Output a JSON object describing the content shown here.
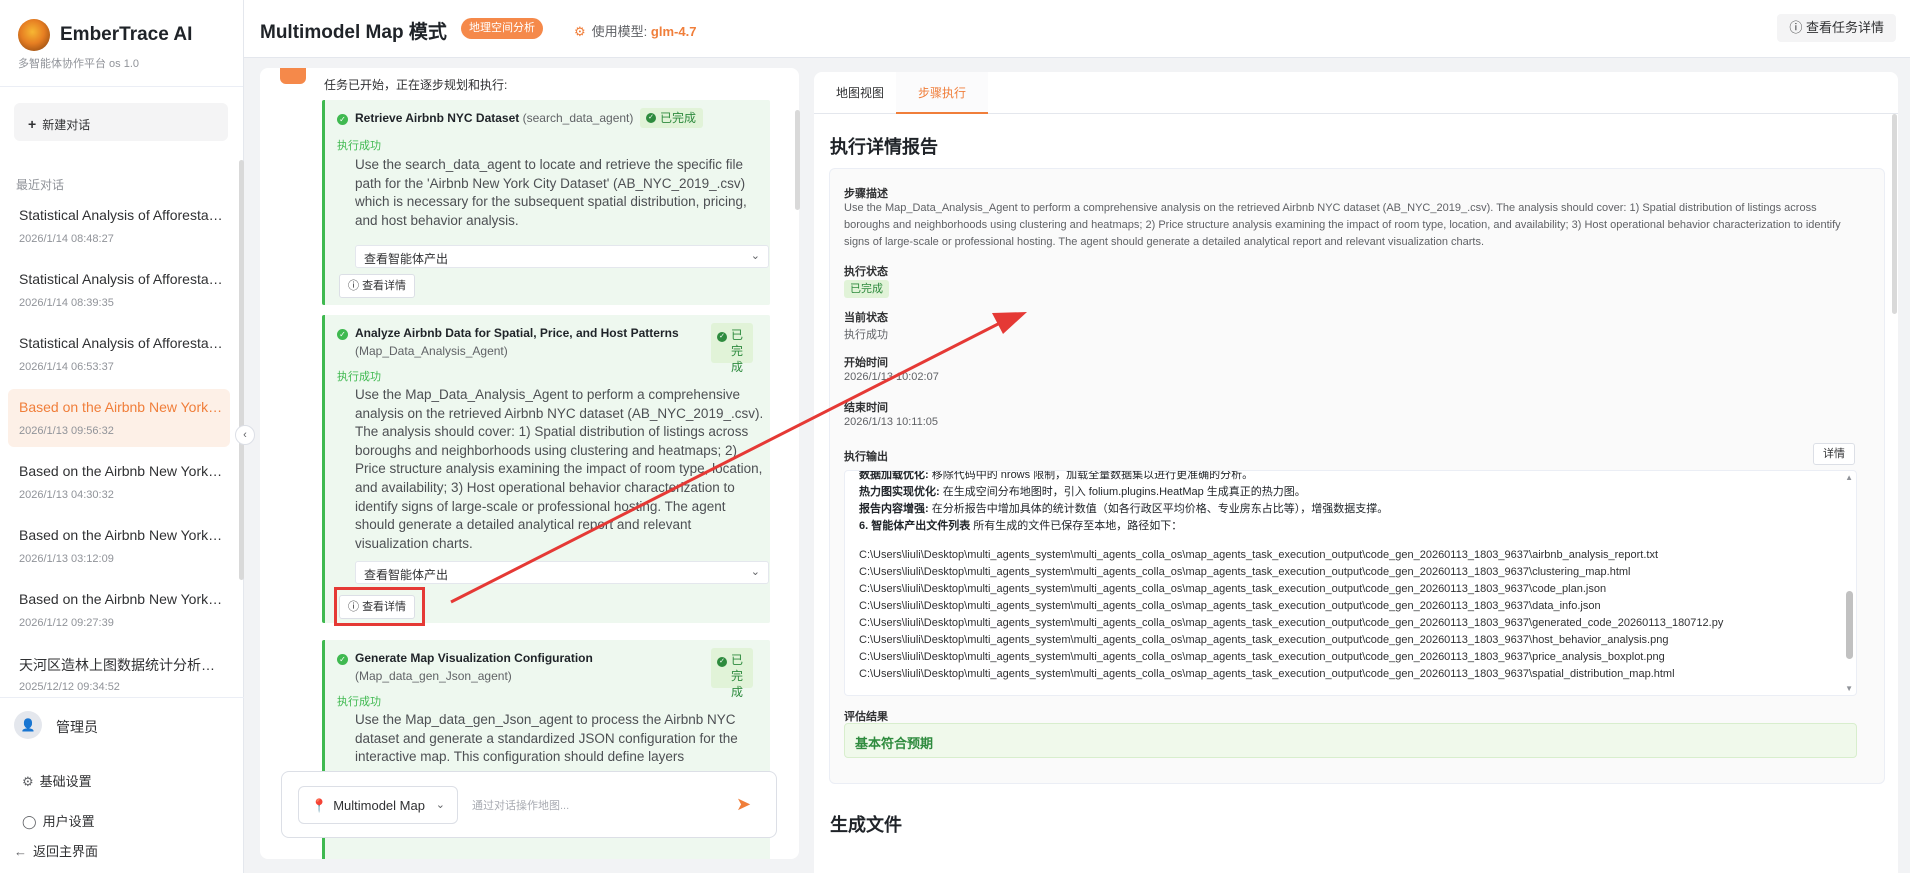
{
  "app": {
    "name": "EmberTrace AI",
    "subtitle": "多智能体协作平台 os 1.0"
  },
  "sidebar": {
    "new_chat": "新建对话",
    "recent_label": "最近对话",
    "history": [
      {
        "title": "Statistical Analysis of Afforestation...",
        "date": "2026/1/14 08:48:27",
        "active": false
      },
      {
        "title": "Statistical Analysis of Afforestation...",
        "date": "2026/1/14 08:39:35",
        "active": false
      },
      {
        "title": "Statistical Analysis of Afforestation...",
        "date": "2026/1/14 06:53:37",
        "active": false
      },
      {
        "title": "Based on the Airbnb New York City...",
        "date": "2026/1/13 09:56:32",
        "active": true
      },
      {
        "title": "Based on the Airbnb New York City...",
        "date": "2026/1/13 04:30:32",
        "active": false
      },
      {
        "title": "Based on the Airbnb New York City...",
        "date": "2026/1/13 03:12:09",
        "active": false
      },
      {
        "title": "Based on the Airbnb New York City...",
        "date": "2026/1/12 09:27:39",
        "active": false
      },
      {
        "title": "天河区造林上图数据统计分析及可视化",
        "date": "2025/12/12 09:34:52",
        "active": false
      }
    ],
    "user": "管理员",
    "settings": "基础设置",
    "user_settings": "用户设置",
    "back": "返回主界面"
  },
  "header": {
    "title": "Multimodel Map 模式",
    "badge": "地理空间分析",
    "model_label": "使用模型:",
    "model_value": "glm-4.7",
    "task_detail": "查看任务详情"
  },
  "chat": {
    "intro": "任务已开始，正在逐步规划和执行:",
    "tasks": [
      {
        "title": "Retrieve Airbnb NYC Dataset",
        "agent": "(search_data_agent)",
        "status": "已完成",
        "result": "执行成功",
        "desc": "Use the search_data_agent to locate and retrieve the specific file path for the 'Airbnb New York City Dataset' (AB_NYC_2019_.csv) which is necessary for the subsequent spatial distribution, pricing, and host behavior analysis.",
        "select": "查看智能体产出",
        "detail": "查看详情"
      },
      {
        "title": "Analyze Airbnb Data for Spatial, Price, and Host Patterns",
        "agent": "(Map_Data_Analysis_Agent)",
        "status_line1": "已完",
        "status_line2": "成",
        "result": "执行成功",
        "desc": "Use the Map_Data_Analysis_Agent to perform a comprehensive analysis on the retrieved Airbnb NYC dataset (AB_NYC_2019_.csv). The analysis should cover: 1) Spatial distribution of listings across boroughs and neighborhoods using clustering and heatmaps; 2) Price structure analysis examining the impact of room type, location, and availability; 3) Host operational behavior characterization to identify signs of large-scale or professional hosting. The agent should generate a detailed analytical report and relevant visualization charts.",
        "select": "查看智能体产出",
        "detail": "查看详情"
      },
      {
        "title": "Generate Map Visualization Configuration",
        "agent": "(Map_data_gen_Json_agent)",
        "status_line1": "已完",
        "status_line2": "成",
        "result": "执行成功",
        "desc": "Use the Map_data_gen_Json_agent to process the Airbnb NYC dataset and generate a standardized JSON configuration for the interactive map. This configuration should define layers"
      }
    ],
    "mode": "Multimodel Map",
    "placeholder": "通过对话操作地图..."
  },
  "right": {
    "tabs": [
      "地图视图",
      "步骤执行"
    ],
    "active_tab": 1,
    "report_title": "执行详情报告",
    "step_desc_label": "步骤描述",
    "step_desc": "Use the Map_Data_Analysis_Agent to perform a comprehensive analysis on the retrieved Airbnb NYC dataset (AB_NYC_2019_.csv). The analysis should cover: 1) Spatial distribution of listings across boroughs and neighborhoods using clustering and heatmaps; 2) Price structure analysis examining the impact of room type, location, and availability; 3) Host operational behavior characterization to identify signs of large-scale or professional hosting. The agent should generate a detailed analytical report and relevant visualization charts.",
    "exec_status_label": "执行状态",
    "exec_status": "已完成",
    "current_status_label": "当前状态",
    "current_status": "执行成功",
    "start_label": "开始时间",
    "start_time": "2026/1/13 10:02:07",
    "end_label": "结束时间",
    "end_time": "2026/1/13 10:11:05",
    "output_label": "执行输出",
    "output_detail": "详情",
    "output_lines": [
      {
        "bold": "数据加载优化:",
        "text": " 移除代码中的 nrows 限制，加载全量数据集以进行更准确的分析。"
      },
      {
        "bold": "热力图实现优化:",
        "text": " 在生成空间分布地图时，引入 folium.plugins.HeatMap 生成真正的热力图。"
      },
      {
        "bold": "报告内容增强:",
        "text": " 在分析报告中增加具体的统计数值（如各行政区平均价格、专业房东占比等），增强数据支撑。"
      },
      {
        "bold": "6. 智能体产出文件列表",
        "text": " 所有生成的文件已保存至本地，路径如下："
      }
    ],
    "output_paths": [
      "C:\\Users\\liuli\\Desktop\\multi_agents_system\\multi_agents_colla_os\\map_agents_task_execution_output\\code_gen_20260113_1803_9637\\airbnb_analysis_report.txt",
      "C:\\Users\\liuli\\Desktop\\multi_agents_system\\multi_agents_colla_os\\map_agents_task_execution_output\\code_gen_20260113_1803_9637\\clustering_map.html",
      "C:\\Users\\liuli\\Desktop\\multi_agents_system\\multi_agents_colla_os\\map_agents_task_execution_output\\code_gen_20260113_1803_9637\\code_plan.json",
      "C:\\Users\\liuli\\Desktop\\multi_agents_system\\multi_agents_colla_os\\map_agents_task_execution_output\\code_gen_20260113_1803_9637\\data_info.json",
      "C:\\Users\\liuli\\Desktop\\multi_agents_system\\multi_agents_colla_os\\map_agents_task_execution_output\\code_gen_20260113_1803_9637\\generated_code_20260113_180712.py",
      "C:\\Users\\liuli\\Desktop\\multi_agents_system\\multi_agents_colla_os\\map_agents_task_execution_output\\code_gen_20260113_1803_9637\\host_behavior_analysis.png",
      "C:\\Users\\liuli\\Desktop\\multi_agents_system\\multi_agents_colla_os\\map_agents_task_execution_output\\code_gen_20260113_1803_9637\\price_analysis_boxplot.png",
      "C:\\Users\\liuli\\Desktop\\multi_agents_system\\multi_agents_colla_os\\map_agents_task_execution_output\\code_gen_20260113_1803_9637\\spatial_distribution_map.html"
    ],
    "eval_label": "评估结果",
    "eval_value": "基本符合预期",
    "files_title": "生成文件"
  },
  "colors": {
    "accent": "#f07e3a",
    "success": "#3fb950",
    "highlight": "#e53935"
  }
}
